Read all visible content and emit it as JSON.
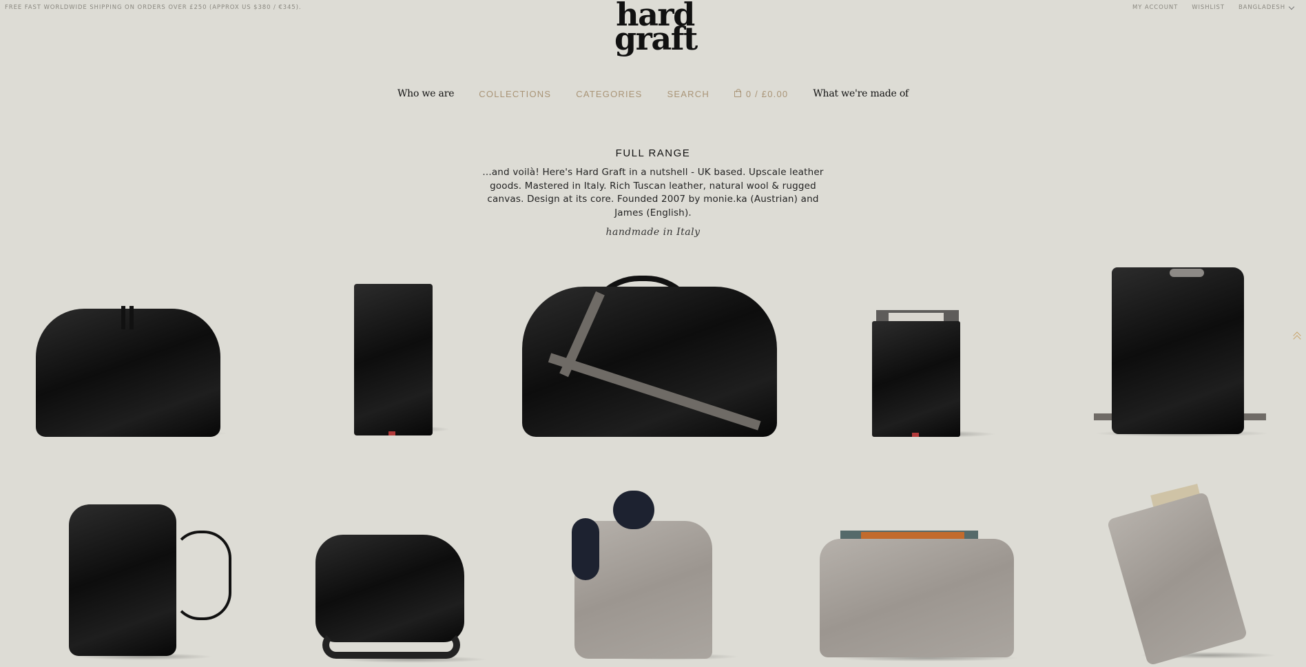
{
  "topbar": {
    "shipping": "FREE FAST WORLDWIDE SHIPPING ON ORDERS OVER £250 (APPROX US $380 / €345).",
    "my_account": "MY ACCOUNT",
    "wishlist": "WISHLIST",
    "country": "BANGLADESH"
  },
  "logo": {
    "line1": "hard",
    "line2": "graft"
  },
  "nav": {
    "who": "Who we are",
    "collections": "COLLECTIONS",
    "categories": "CATEGORIES",
    "search": "SEARCH",
    "cart": "0 / £0.00",
    "made_of": "What we're made of"
  },
  "intro": {
    "title": "FULL RANGE",
    "text": "...and voilà! Here's Hard Graft in a nutshell - UK based. Upscale leather goods. Mastered in Italy. Rich Tuscan leather, natural wool & rugged canvas. Design at its core. Founded 2007 by monie.ka (Austrian) and James (English).",
    "script": "handmade in Italy"
  },
  "colors": {
    "background": "#dddcd5",
    "accent": "#a99476"
  },
  "icons": [
    "bag-icon",
    "chevron-down-icon",
    "scroll-up-icon"
  ]
}
